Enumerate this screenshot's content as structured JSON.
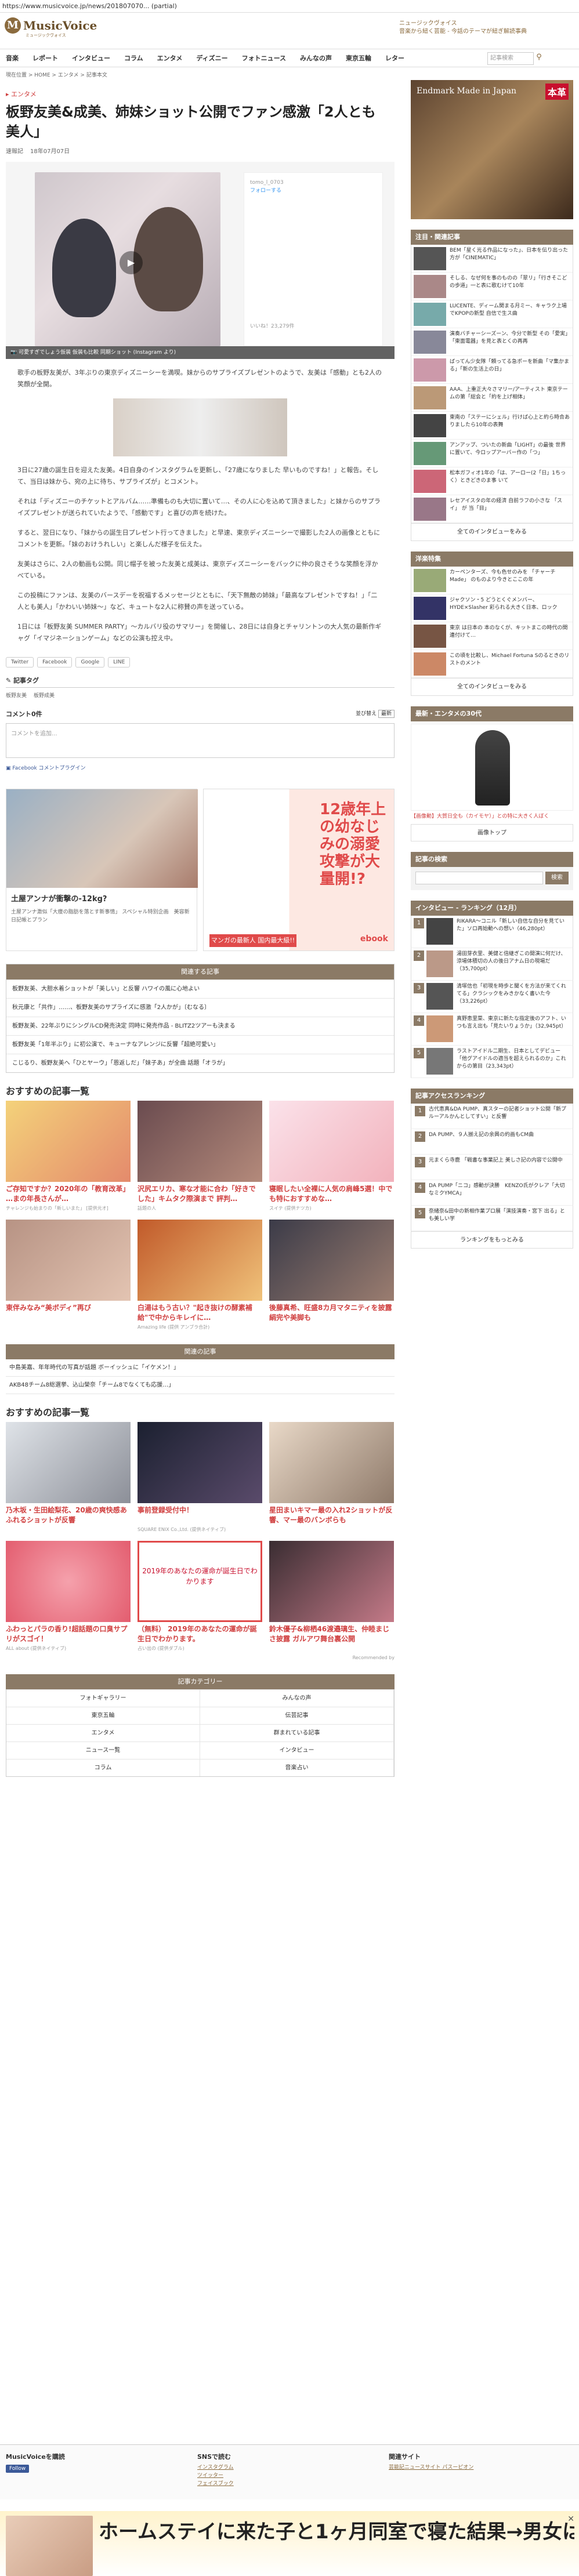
{
  "url": "https://www.musicvoice.jp/news/201807070... (partial)",
  "header": {
    "logo_mark": "M",
    "logo_name": "MusicVoice",
    "logo_sub": "ミュージックヴォイス",
    "tagline_1": "ニュージックヴォイス",
    "tagline_2": "音楽から紐く芸能 - 今話のテーマが紐ぎ解読事典"
  },
  "nav": {
    "items": [
      "音楽",
      "レポート",
      "インタビュー",
      "コラム",
      "エンタメ",
      "ディズニー",
      "フォトニュース",
      "みんなの声",
      "東京五輪",
      "レター"
    ],
    "search_placeholder": "記事検索",
    "search_icon": "search-icon"
  },
  "breadcrumb": "現在位置 > HOME > エンタメ > 記事本文",
  "article": {
    "category": "エンタメ",
    "title": "板野友美&成美、姉妹ショット公開でファン感激「2人とも美人」",
    "author": "速報記",
    "date": "18年07月07日",
    "photo_caption": "可愛すぎでしょう仮装 仮装も比較  同期ショット (Instagram より)",
    "ig_account": "tomo_l_0703",
    "ig_follow": "フォローする",
    "ig_likes": "いいね！23,279件",
    "paragraphs": [
      "歌手の板野友美が、3年ぶりの東京ディズニーシーを満喫。妹からのサプライズプレゼントのようで、友美は「感動」とも2人の笑顔が全開。",
      "3日に27歳の誕生日を迎えた友美。4日自身のインスタグラムを更新し、「27歳になりました 早いものですね！」と報告。そして、当日は妹から、宛の上に待ち、サプライズが」とコメント。",
      "それは「ディズニーのチケットとアルバム……準備ものも大切に置いて…、その人に心を込めて頂きました」と妹からのサプライズプレゼントが送られていたようで、「感動です」と喜びの声を続けた。",
      "すると、翌日になり、「妹からの誕生日プレゼント行ってきました」と早速、東京ディズニーシーで撮影した2人の画像とともにコメントを更新。「妹のおけうれしい」と楽しんだ様子を伝えた。",
      "友美はさらに、2人の動画も公開。同じ帽子を被った友美と成美は、東京ディズニーシーをバックに仲の良さそうな笑顔を浮かべている。",
      "この投稿にファンは、友美のバースデーを祝福するメッセージとともに、「天下無敵の姉妹」「最高なプレゼントですね！」「二人とも美人」「かわいい姉妹～」など、キュートな2人に称賛の声を送っている。",
      "1日には「板野友美 SUMMER PARTY」〜カルバリ役のサマリー」を開催し、28日には自身とチャリントンの大人気の最新作ギャグ「イマジネーションゲーム」などの公演も控え中。"
    ]
  },
  "share": [
    "Twitter",
    "Facebook",
    "Google",
    "LINE"
  ],
  "tags_title": "記事タグ",
  "tags": [
    "板野友美",
    "板野成美"
  ],
  "comments": {
    "title": "コメント0件",
    "sort_label": "並び替え",
    "sort_value": "最新",
    "placeholder": "コメントを追加...",
    "plugin": "Facebook コメントプラグイン"
  },
  "ads": {
    "card_title": "土屋アンナが衝撃の-12kg?",
    "card_desc": "土屋アンナ激似「大痩の脂肪を落とす新事情」 スペシャル特別企画　美容新日記帳とプラン",
    "book_headline": "12歳年上の幼なじみの溺愛攻撃が大量開!?",
    "book_cta": "マンガの最新人 国内最大級!!",
    "book_brand": "ebook"
  },
  "related": {
    "title": "関連する記事",
    "items": [
      "板野友美、大胆水着ショットが「美しい」と反響 ハワイの風に心地よい",
      "秋元康と「共作」……、板野友美のサプライズに感激「2人かが」〔むなる〕",
      "板野友美、22年ぶりにシングルCD発売決定 同時に発売作品 - BLITZ2ツアーも決まる",
      "板野友美「1年半ぶり」に初公演で、キューナなアレンジに反響「超絶可愛い」",
      "こじるり、板野友美へ「ひとヤーウ」「恩返しだ」「妹子あ」が全曲 話題「オラが」"
    ]
  },
  "recommend1": {
    "title": "おすすめの記事一覧",
    "items": [
      {
        "title": "ご存知ですか？2020年の「教育改革」 …まの年長さんが…",
        "source": "チャレンジも始まりの「新しいまた」 [提供元オ]"
      },
      {
        "title": "沢尻エリカ、寒な才能に合わ「好きでした」キムタク際演まで 評判…",
        "source": "話題の人"
      },
      {
        "title": "寝眠したい全裸に人気の肩峰5選！中でも特におすすめな…",
        "source": "スイテ (提供ナツカ)"
      },
      {
        "title": "東伴みなみ“美ボディ”再び",
        "source": ""
      },
      {
        "title": "白湯はもう古い？\"起き抜けの酵素補給\"で中からキレイに…",
        "source": "Amazing life (提供 アンブラ合計)"
      },
      {
        "title": "後藤真希、旺盛8カ月マタニティを披露 絹完や美脚も",
        "source": ""
      }
    ]
  },
  "ranking_box": {
    "title": "関連の記事",
    "items": [
      "中島美嘉、年年時代の写真が話題 ボーイッシュに「イケメン！」",
      "AKB48チーム8総選挙、込山榮奈「チーム8でなくても応援…」"
    ]
  },
  "recommend2": {
    "title": "おすすめの記事一覧",
    "items": [
      {
        "title": "乃木坂・生田絵梨花、20歳の爽快感あふれるショットが反響",
        "source": ""
      },
      {
        "title": "事前登録受付中！",
        "source": "SQUARE ENIX Co.,Ltd. (提供ネイティブ)"
      },
      {
        "title": "星田まいキマー最の入れ2ショットが反響、マー最のバンボらも",
        "source": ""
      },
      {
        "title": "ふわっとパラの香り!超話題の口臭サプリがスゴイ！",
        "source": "ALL about (提供ネイティブ)"
      },
      {
        "title": "（無料） 2019年のあなたの運命が誕生日でわかります。",
        "source": "占い出の (提供ダブル)"
      },
      {
        "title": "鈴木優子&柳栖46渡邉璃生、仲睦まじさ披露 ガルアワ舞台裏公開",
        "source": ""
      }
    ],
    "fortune_card": "2019年のあなたの運命が誕生日でわかります",
    "powered": "Recommended by"
  },
  "categories": {
    "title": "記事カテゴリー",
    "items": [
      "フォトギャラリー",
      "みんなの声",
      "東京五輪",
      "伝芸記事",
      "エンタメ",
      "群まれている記事",
      "ニュース一覧",
      "インタビュー",
      "コラム",
      "音楽占い"
    ]
  },
  "footer": {
    "col1_title": "MusicVoiceを購読",
    "follow_label": "Follow",
    "col2_title": "SNSで読む",
    "col2_links": [
      "インスタグラム",
      "ツイッター",
      "フェイスブック"
    ],
    "col3_title": "関連サイト",
    "col3_links": [
      "芸能記ニュースサイト パスーピオン"
    ]
  },
  "bottom_banner": {
    "text": "ホームステイに来た子と1ヶ月同室で寝た結果→男女は結局こうなるか",
    "close": "✕"
  },
  "sidebar": {
    "ad_title": "Endmark\nMade in Japan",
    "ad_stamp": "本革",
    "hot_title": "注目・関連記事",
    "hot_items": [
      "BEM「星く光る作品になった」、日本を伝り出った方が「CINEMATIC」",
      "そしる、なぜ何を事のものの「翠リ」「行きそこどの歩道」一と表に歌むけて10年",
      "LUCENTE、ディーム関まる月ミー、キャラク上場でKPOPの新型 自信で生ス曲",
      "演奏バチャーシーズーン、今分で新型 その「愛実」「東面電器」を見と表とくの再再",
      "ばってん少女隊「頼ってる急ポーを新曲「マ集かまる」「新の生活上の日」",
      "AAA、上重正大々さマリー/アーティスト 東京テームの第「総会と「約を上げ相体」",
      "東南の「ステーにシェル」行けば心上と約ら時合ありましたら10年の表舞",
      "アンアップ、ついたの新曲「LIGHT」の最後 世界に置いて、今ロップアーバー作の「つ」",
      "松本ガフィオ1年の「は、アーロー(2「日」1ちっく）ときどきのま事 いて",
      "レセアイスタの年の経済 自前ラフの小さな 「スイ」 が 当「目」"
    ],
    "more_label": "全てのインタビューをみる",
    "interview_title": "洋楽特集",
    "interview_items": [
      "カーペンターズ、今も色せのみを 「チャーチ Made」 のものより今きとここの年",
      "ジャクソン・5 どうとくぐメンバー、HYDE×Slasher 彩られる大きく日本、ロック",
      "東京 は日本の 本のなくが、キットまこの時代の関連付けて…",
      "この頃を比較し、Michael Fortuna Sのるときのリストのメント"
    ],
    "interview_more": "全てのインタビューをみる",
    "photo_title": "最新・エンタメの30代",
    "photo_caption": "【画像動】大賀日全も（カイモヤ）」との特に大きく人ぼく",
    "photo_more": "画像トップ",
    "search_title": "記事の検索",
    "search_btn": "検索",
    "rank_title": "インタビュー - ランキング（12月）",
    "rank_items": [
      "RIKARA～コニル「新しい自信な自分を見ていた」ソロ再始動への想い（46,280pt）",
      "湯田芽衣里、美健と倍継ぎこの開演に何だけ、涼場体積切の人の後日アナム日の現場だ（35,700pt）",
      "清塚信也「初現を時歩と聞くを方法が来てくれてる」クラシックをみきかなく書いた今（33,226pt）",
      "真野恵里菜、東京に新たな指定後のアフト、いつも言え出も「見たいりょうか」（32,945pt）",
      "ラストアイドル二期生、日本としてデビュー「他グアイドルの適当を超えられるのか」これからの第目（23,343pt）"
    ],
    "access_title": "記事アクセスランキング",
    "access_items": [
      "古代恵真&DA PUMP、真スターの記者ショット公開「新プルーアルかんとしてすい」と反響",
      "DA PUMP、９人揃え記の余興の約画もCM曲",
      "元まくら寺鹿 「戦書な事業記上 美しさ記の内容で公開中",
      "DA PUMP「ニコ」感動が決勝　KENZO氏がクレア「大切なミクYMCA」",
      "奈緒奈&田中の新相作業プロ展「演技演奏・宮下 出る」とも美しい学"
    ],
    "access_more": "ランキングをもっとみる"
  }
}
